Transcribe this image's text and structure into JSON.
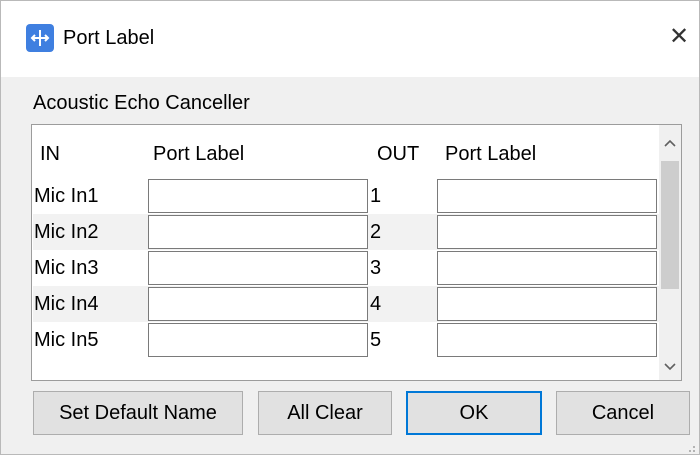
{
  "window": {
    "title": "Port Label",
    "close_symbol": "✕",
    "icon": "port-label-app-icon",
    "accent_color": "#3f7fe0"
  },
  "group_label": "Acoustic Echo Canceller",
  "table": {
    "headers": {
      "in": "IN",
      "in_label": "Port Label",
      "out": "OUT",
      "out_label": "Port Label"
    },
    "rows": [
      {
        "in": "Mic In1",
        "in_label": "",
        "out": "1",
        "out_label": ""
      },
      {
        "in": "Mic In2",
        "in_label": "",
        "out": "2",
        "out_label": ""
      },
      {
        "in": "Mic In3",
        "in_label": "",
        "out": "3",
        "out_label": ""
      },
      {
        "in": "Mic In4",
        "in_label": "",
        "out": "4",
        "out_label": ""
      },
      {
        "in": "Mic In5",
        "in_label": "",
        "out": "5",
        "out_label": ""
      }
    ],
    "scroll_up_symbol": "^",
    "scroll_down_symbol": "v"
  },
  "buttons": {
    "set_default_name": "Set Default Name",
    "all_clear": "All Clear",
    "ok": "OK",
    "cancel": "Cancel"
  }
}
